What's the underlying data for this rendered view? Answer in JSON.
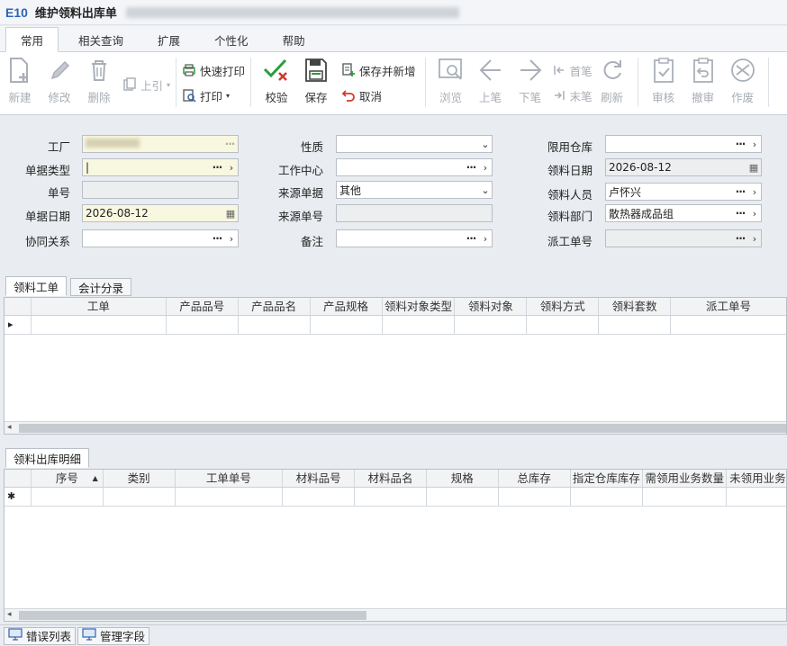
{
  "window": {
    "app_logo": "E10",
    "title": "维护领料出库单"
  },
  "ribbon": {
    "tabs": [
      {
        "label": "常用"
      },
      {
        "label": "相关查询"
      },
      {
        "label": "扩展"
      },
      {
        "label": "个性化"
      },
      {
        "label": "帮助"
      }
    ]
  },
  "toolbar": {
    "new": "新建",
    "modify": "修改",
    "delete": "删除",
    "upref": "上引",
    "quick_print": "快速打印",
    "print": "打印",
    "verify": "校验",
    "save": "保存",
    "save_new": "保存并新增",
    "cancel": "取消",
    "browse": "浏览",
    "prev": "上笔",
    "next": "下笔",
    "first": "首笔",
    "last": "末笔",
    "refresh": "刷新",
    "approve": "审核",
    "unapprove": "撤审",
    "void": "作废"
  },
  "form": {
    "factory_label": "工厂",
    "doc_type_label": "单据类型",
    "doc_type_value": "|",
    "doc_no_label": "单号",
    "doc_date_label": "单据日期",
    "doc_date_value": "2026-08-12",
    "collab_label": "协同关系",
    "nature_label": "性质",
    "work_center_label": "工作中心",
    "source_doc_label": "来源单据",
    "source_doc_value": "其他",
    "source_no_label": "来源单号",
    "remark_label": "备注",
    "limit_wh_label": "限用仓库",
    "pick_date_label": "领料日期",
    "pick_date_value": "2026-08-12",
    "picker_label": "领料人员",
    "picker_value": "卢怀兴",
    "pick_dept_label": "领料部门",
    "pick_dept_value": "散热器成品组",
    "dispatch_no_label": "派工单号"
  },
  "upper_grid": {
    "tabs": [
      {
        "label": "领料工单"
      },
      {
        "label": "会计分录"
      }
    ],
    "columns": [
      "工单",
      "产品品号",
      "产品品名",
      "产品规格",
      "领料对象类型",
      "领料对象",
      "领料方式",
      "领料套数",
      "派工单号"
    ],
    "row_marker": "▸"
  },
  "lower_grid": {
    "tabs": [
      {
        "label": "领料出库明细"
      }
    ],
    "columns": [
      "序号",
      "类别",
      "工单单号",
      "材料品号",
      "材料品名",
      "规格",
      "总库存",
      "指定仓库库存",
      "需领用业务数量",
      "未领用业务"
    ],
    "sort_indicator": "▲",
    "row_marker": "✱"
  },
  "statusbar": {
    "error_list": "错误列表",
    "manage_fields": "管理字段"
  },
  "colors": {
    "accent": "#2f63b5",
    "yellow_field": "#f8f7e0",
    "verify_green": "#2e9b3c",
    "cancel_red": "#d03a2a"
  }
}
